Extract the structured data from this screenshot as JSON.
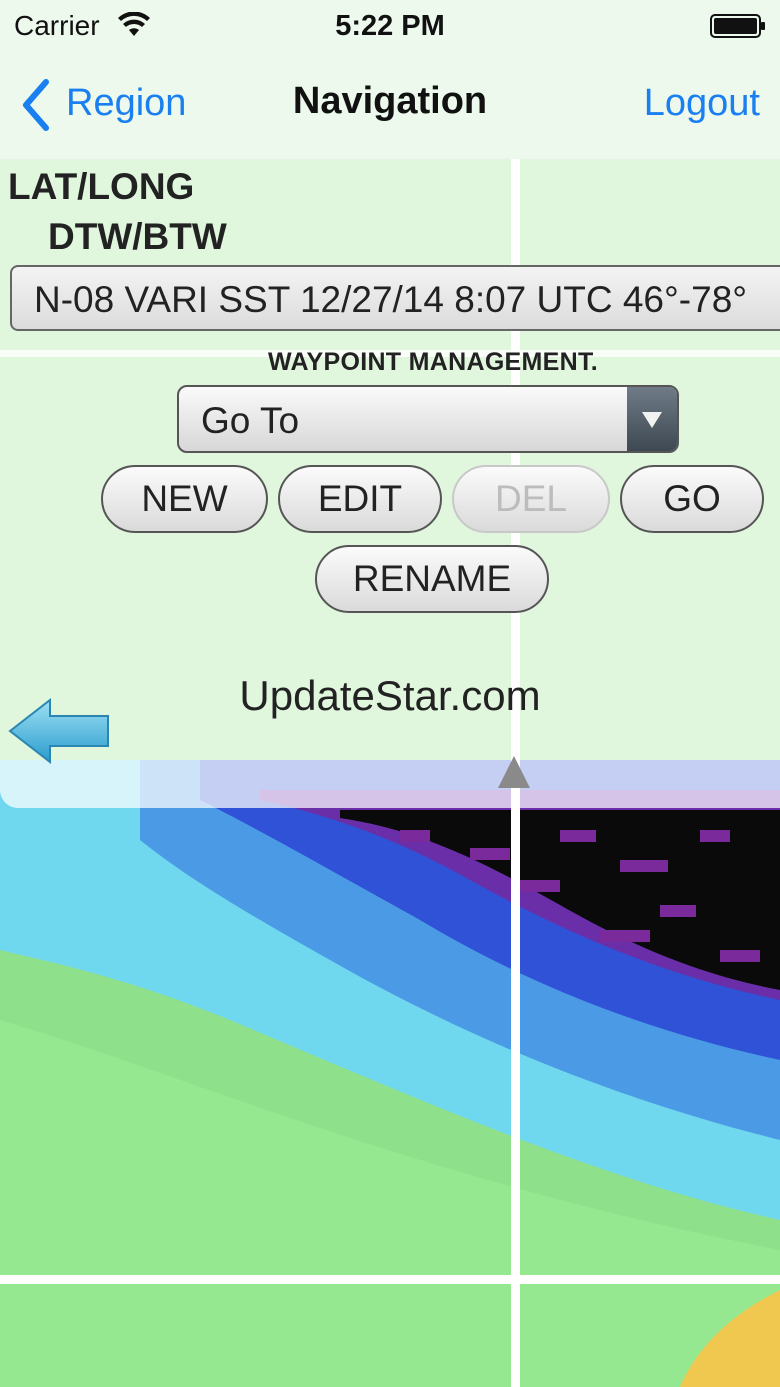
{
  "status_bar": {
    "carrier": "Carrier",
    "time": "5:22 PM",
    "wifi_icon": "wifi-icon",
    "battery_icon": "battery-icon"
  },
  "nav_bar": {
    "back_label": "Region",
    "title": "Navigation",
    "right_action": "Logout",
    "accent_color": "#1a7ff0"
  },
  "panel": {
    "mode_line1": "LAT/LONG",
    "mode_line2": "DTW/BTW",
    "info": "N-08 VARI SST 12/27/14 8:07 UTC 46°-78°",
    "waypoint_title": "WAYPOINT MANAGEMENT.",
    "waypoint_select": "Go To",
    "buttons": {
      "new": "NEW",
      "edit": "EDIT",
      "del": "DEL",
      "go": "GO",
      "rename": "RENAME"
    },
    "watermark": "UpdateStar.com"
  },
  "map": {
    "colors": {
      "ocean_green": "#8fe08a",
      "light_blue": "#5fd0f0",
      "blue": "#3a7ae0",
      "purple": "#7a2a9a",
      "black": "#0a0a0a",
      "yellow": "#f0c850",
      "grid": "#ffffff"
    }
  }
}
